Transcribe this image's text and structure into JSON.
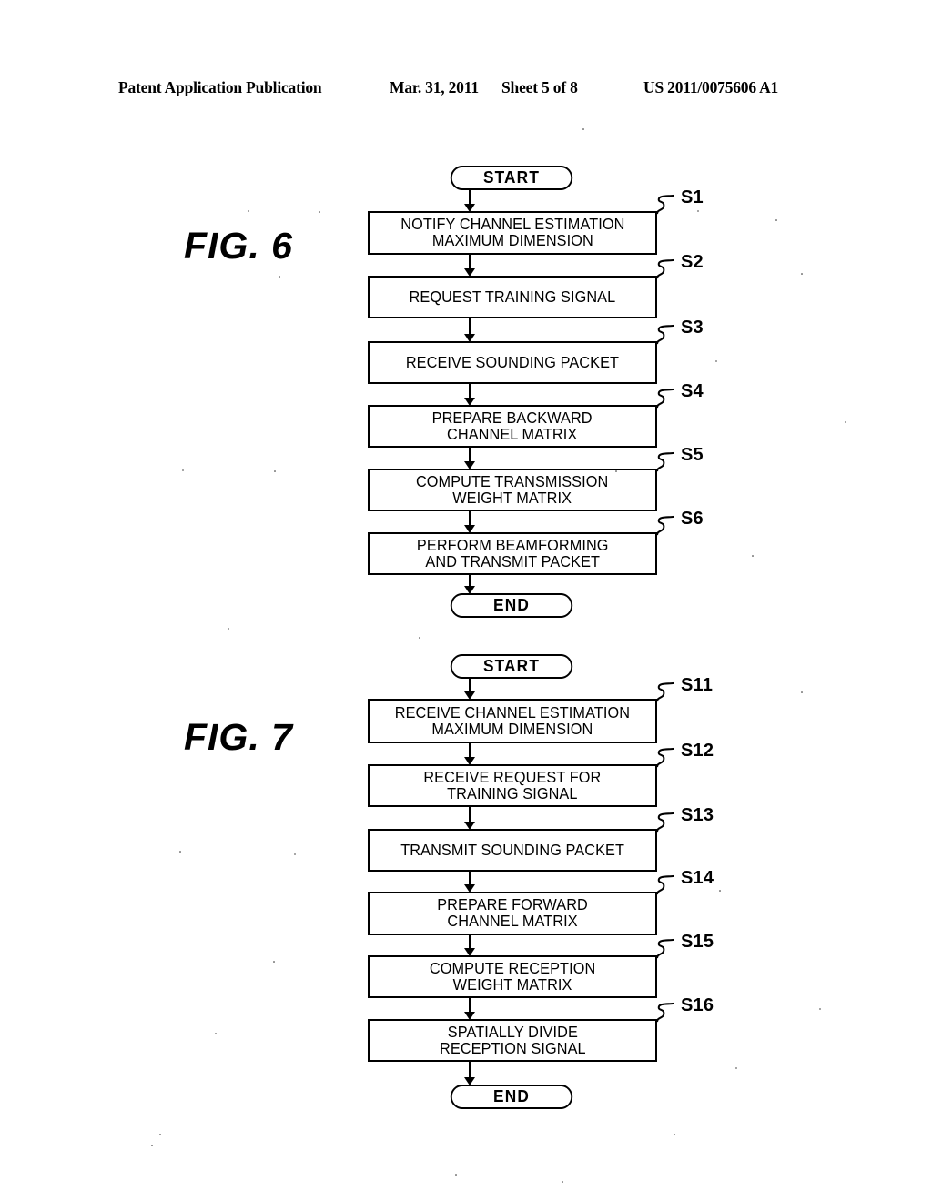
{
  "header": {
    "publication": "Patent Application Publication",
    "date": "Mar. 31, 2011",
    "sheet": "Sheet 5 of 8",
    "patent_number": "US 2011/0075606 A1"
  },
  "figures": [
    {
      "id": "fig6",
      "label": "FIG.  6",
      "start_label": "START",
      "end_label": "END",
      "steps": [
        {
          "ref": "S1",
          "text": "NOTIFY CHANNEL ESTIMATION\nMAXIMUM DIMENSION",
          "lines": 2
        },
        {
          "ref": "S2",
          "text": "REQUEST TRAINING SIGNAL",
          "lines": 1
        },
        {
          "ref": "S3",
          "text": "RECEIVE SOUNDING PACKET",
          "lines": 1
        },
        {
          "ref": "S4",
          "text": "PREPARE BACKWARD\nCHANNEL MATRIX",
          "lines": 2
        },
        {
          "ref": "S5",
          "text": "COMPUTE TRANSMISSION\nWEIGHT MATRIX",
          "lines": 2
        },
        {
          "ref": "S6",
          "text": "PERFORM BEAMFORMING\nAND TRANSMIT PACKET",
          "lines": 2
        }
      ]
    },
    {
      "id": "fig7",
      "label": "FIG.  7",
      "start_label": "START",
      "end_label": "END",
      "steps": [
        {
          "ref": "S11",
          "text": "RECEIVE CHANNEL ESTIMATION\nMAXIMUM DIMENSION",
          "lines": 2
        },
        {
          "ref": "S12",
          "text": "RECEIVE REQUEST FOR\nTRAINING SIGNAL",
          "lines": 2
        },
        {
          "ref": "S13",
          "text": "TRANSMIT SOUNDING PACKET",
          "lines": 1
        },
        {
          "ref": "S14",
          "text": "PREPARE FORWARD\nCHANNEL MATRIX",
          "lines": 2
        },
        {
          "ref": "S15",
          "text": "COMPUTE RECEPTION\nWEIGHT MATRIX",
          "lines": 2
        },
        {
          "ref": "S16",
          "text": "SPATIALLY DIVIDE\nRECEPTION SIGNAL",
          "lines": 2
        }
      ]
    }
  ],
  "colors": {
    "ink": "#000000",
    "paper": "#ffffff"
  }
}
